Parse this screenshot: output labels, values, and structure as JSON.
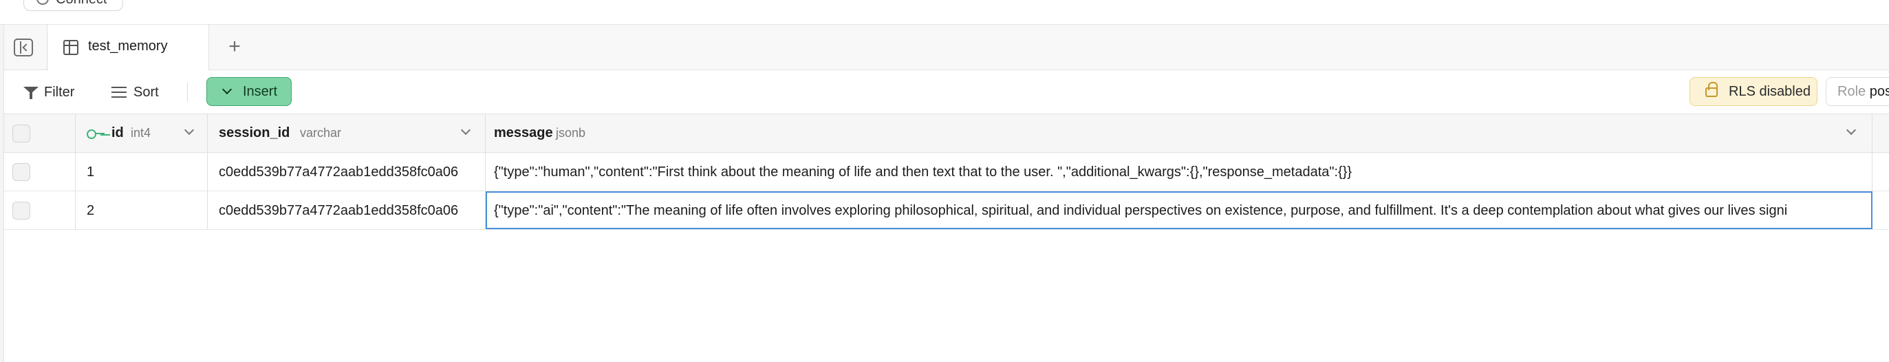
{
  "topbar": {
    "connect_label": "Connect"
  },
  "tabs": [
    {
      "label": "test_memory"
    }
  ],
  "toolbar": {
    "filter_label": "Filter",
    "sort_label": "Sort",
    "insert_label": "Insert",
    "rls_label": "RLS disabled",
    "role_prefix": "Role",
    "role_value": "post"
  },
  "columns": [
    {
      "name": "id",
      "type": "int4"
    },
    {
      "name": "session_id",
      "type": "varchar"
    },
    {
      "name": "message",
      "type": "jsonb"
    }
  ],
  "rows": [
    {
      "id": "1",
      "session_id": "c0edd539b77a4772aab1edd358fc0a06",
      "message": "{\"type\":\"human\",\"content\":\"First think about the meaning of life and then text that to the user. \",\"additional_kwargs\":{},\"response_metadata\":{}}"
    },
    {
      "id": "2",
      "session_id": "c0edd539b77a4772aab1edd358fc0a06",
      "message": "{\"type\":\"ai\",\"content\":\"The meaning of life often involves exploring philosophical, spiritual, and individual perspectives on existence, purpose, and fulfillment. It's a deep contemplation about what gives our lives signi"
    }
  ],
  "colors": {
    "insert_bg": "#7fd4a5",
    "rls_bg": "#fcf3d6",
    "key_icon": "#3fb57a",
    "selection": "#4a90d9"
  }
}
